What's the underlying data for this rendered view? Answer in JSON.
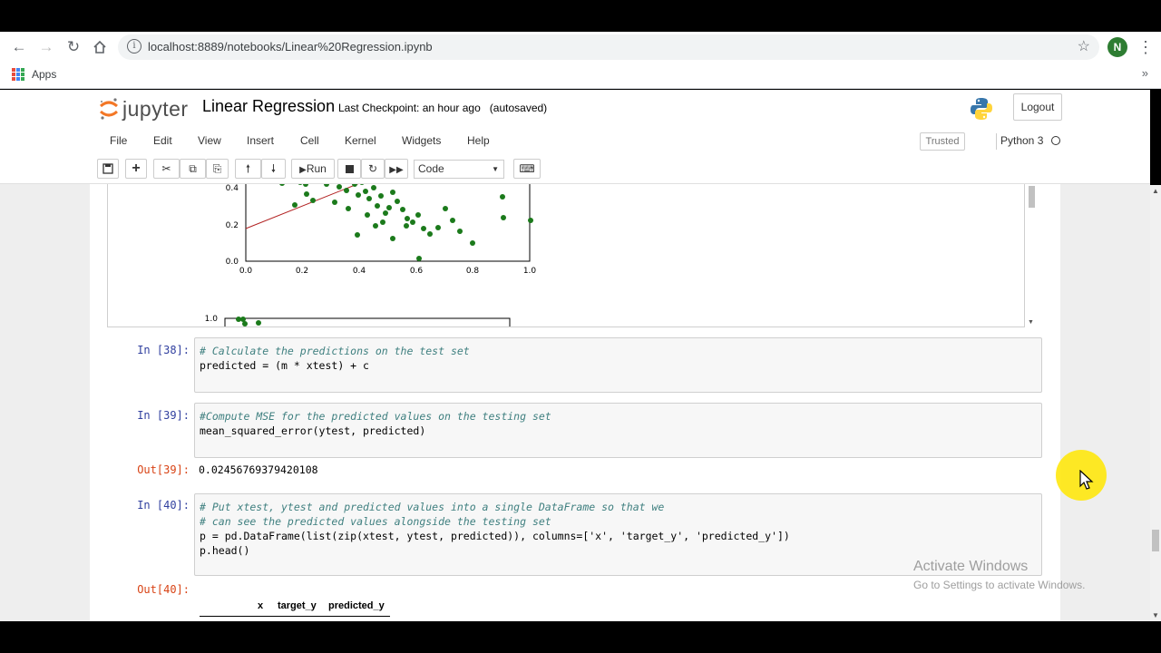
{
  "browser": {
    "url": "localhost:8889/notebooks/Linear%20Regression.ipynb",
    "avatar_letter": "N",
    "bookmarks": {
      "apps_label": "Apps"
    }
  },
  "jupyter": {
    "logo_text": "jupyter",
    "notebook_title": "Linear Regression",
    "checkpoint": "Last Checkpoint: an hour ago",
    "autosave": "(autosaved)",
    "logout_label": "Logout",
    "menu": [
      "File",
      "Edit",
      "View",
      "Insert",
      "Cell",
      "Kernel",
      "Widgets",
      "Help"
    ],
    "trusted_label": "Trusted",
    "kernel_name": "Python 3",
    "toolbar": {
      "run_label": "Run",
      "cell_type": "Code"
    }
  },
  "cells": {
    "plot_output": {
      "y_ticks": [
        "0.4",
        "0.2",
        "0.0"
      ],
      "x_ticks": [
        "0.0",
        "0.2",
        "0.4",
        "0.6",
        "0.8",
        "1.0"
      ],
      "next_plot_y_tick": "1.0"
    },
    "cell38": {
      "prompt": "In [38]:",
      "comment": "# Calculate the predictions on the test set",
      "code": "predicted = (m * xtest) + c"
    },
    "cell39": {
      "prompt": "In [39]:",
      "comment": "#Compute MSE for the predicted values on the testing set",
      "code": "mean_squared_error(ytest, predicted)",
      "out_prompt": "Out[39]:",
      "output": "0.02456769379420108"
    },
    "cell40": {
      "prompt": "In [40]:",
      "comment1": "# Put xtest, ytest and predicted values into a single DataFrame so that we",
      "comment2": "# can see the predicted values alongside the testing set",
      "code1": "p = pd.DataFrame(list(zip(xtest, ytest, predicted)), columns=['x', 'target_y', 'predicted_y'])",
      "code2": "p.head()",
      "out_prompt": "Out[40]:",
      "columns": [
        "x",
        "target_y",
        "predicted_y"
      ]
    }
  },
  "watermark": {
    "line1": "Activate Windows",
    "line2": "Go to Settings to activate Windows."
  },
  "colors": {
    "point_color": "#1b7a1b",
    "fit_line_color": "#b22222",
    "in_prompt": "#303f9f",
    "out_prompt": "#d84315"
  }
}
